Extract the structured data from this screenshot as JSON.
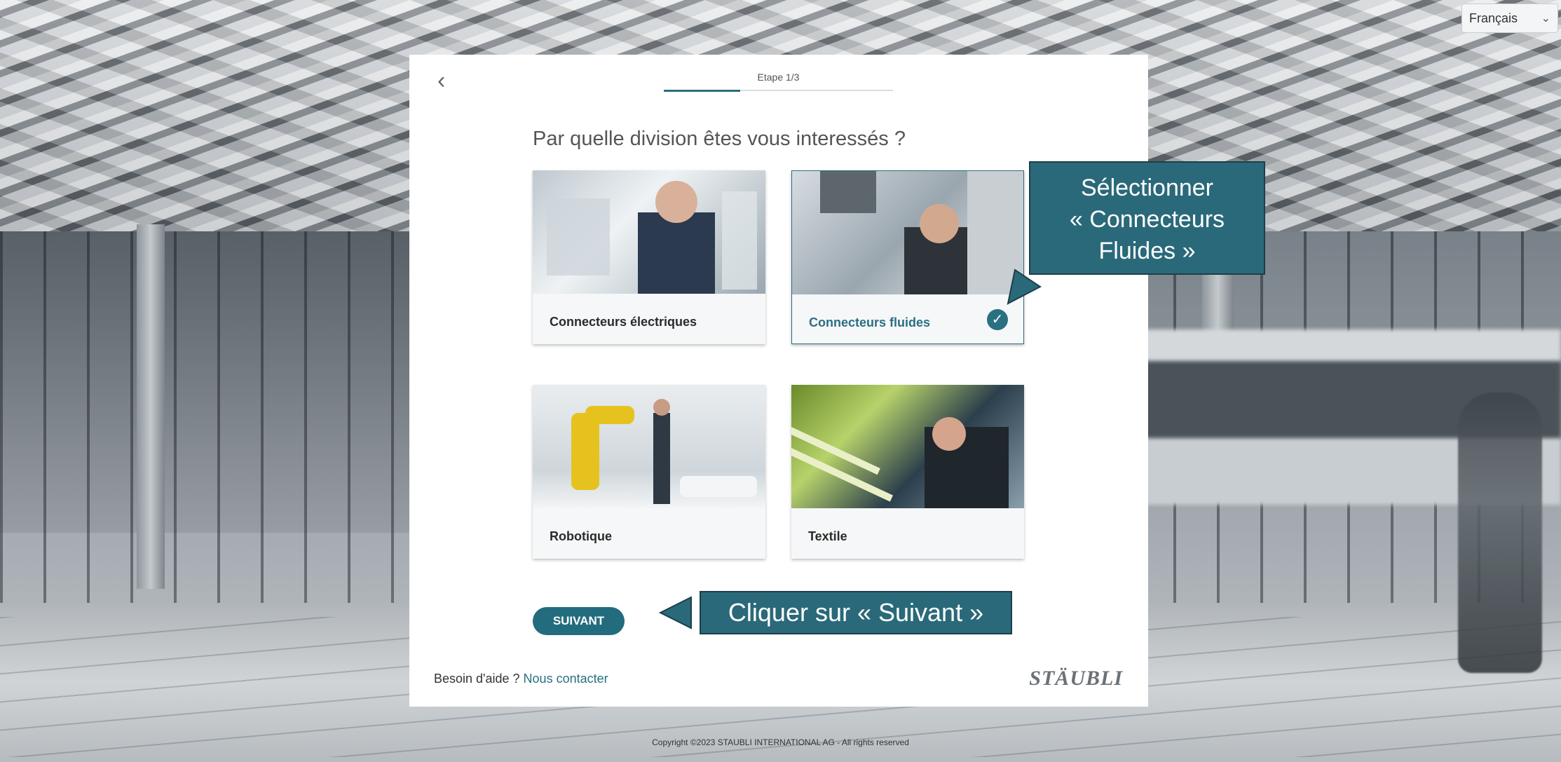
{
  "language": {
    "selected": "Français"
  },
  "wizard": {
    "step_label": "Etape 1/3",
    "progress_fraction": 0.3333,
    "question": "Par quelle division êtes vous interessés ?",
    "divisions": [
      {
        "label": "Connecteurs électriques",
        "selected": false
      },
      {
        "label": "Connecteurs fluides",
        "selected": true
      },
      {
        "label": "Robotique",
        "selected": false
      },
      {
        "label": "Textile",
        "selected": false
      }
    ],
    "next_label": "SUIVANT"
  },
  "help": {
    "text": "Besoin d'aide ?",
    "link": "Nous contacter"
  },
  "brand": {
    "logo": "STÄUBLI",
    "accent_color": "#2a6f82"
  },
  "annotations": {
    "select_line1": "Sélectionner",
    "select_line2": "« Connecteurs",
    "select_line3": "Fluides »",
    "next_hint": "Cliquer sur « Suivant »"
  },
  "footer": {
    "copyright": "Copyright ©2023 STAUBLI INTERNATIONAL AG - All rights reserved"
  }
}
